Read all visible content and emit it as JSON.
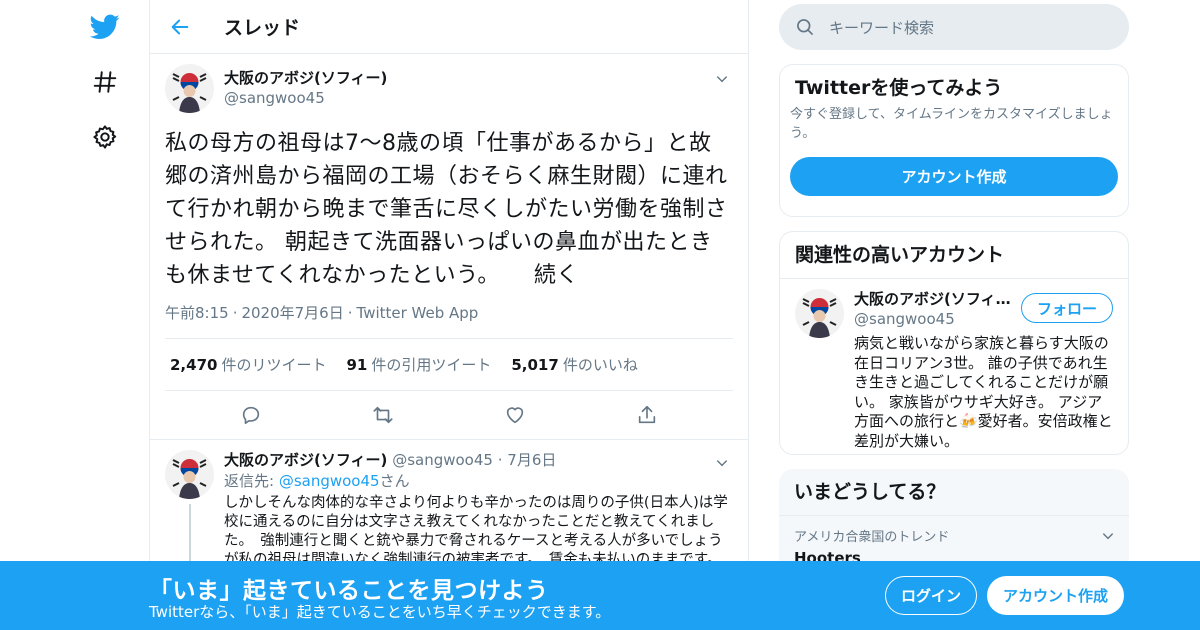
{
  "colors": {
    "accent": "#1da1f2",
    "muted": "#657786",
    "border": "#e6ecf0"
  },
  "nav": {
    "icons": [
      "twitter-logo-icon",
      "hashtag-icon",
      "gear-icon"
    ]
  },
  "header": {
    "title": "スレッド"
  },
  "tweet": {
    "author_name": "大阪のアボジ(ソフィー)",
    "author_handle": "@sangwoo45",
    "text": "私の母方の祖母は7～8歳の頃「仕事があるから」と故郷の済州島から福岡の工場（おそらく麻生財閥）に連れて行かれ朝から晩まで筆舌に尽くしがたい労働を強制させられた。 朝起きて洗面器いっぱいの鼻血が出たときも休ませてくれなかったという。　　続く",
    "time": "午前8:15",
    "date": "2020年7月6日",
    "source": "Twitter Web App",
    "retweets": "2,470",
    "retweets_label": "件のリツイート",
    "quotes": "91",
    "quotes_label": "件の引用ツイート",
    "likes": "5,017",
    "likes_label": "件のいいね"
  },
  "reply": {
    "author_name": "大阪のアボジ(ソフィー)",
    "author_handle": "@sangwoo45",
    "date": "7月6日",
    "reply_prefix": "返信先: ",
    "reply_handle": "@sangwoo45",
    "reply_suffix": "さん",
    "text": "しかしそんな肉体的な辛さより何よりも辛かったのは周りの子供(日本人)は学校に通えるのに自分は文字さえ教えてくれなかったことだと教えてくれました。　強制連行と聞くと銃や暴力で脅されるケースと考える人が多いでしょうが私の祖母は間違いなく強制連行の被害者です。　賃金も未払いのままです。"
  },
  "search": {
    "placeholder": "キーワード検索"
  },
  "signup_card": {
    "title": "Twitterを使ってみよう",
    "desc": "今すぐ登録して、タイムラインをカスタマイズしましょう。",
    "button": "アカウント作成"
  },
  "related": {
    "title": "関連性の高いアカウント",
    "name": "大阪のアボジ(ソフィー)",
    "handle": "@sangwoo45",
    "follow": "フォロー",
    "bio": "病気と戦いながら家族と暮らす大阪の在日コリアン3世。 誰の子供であれ生き生きと過ごしてくれることだけが願い。 家族皆がウサギ大好き。 アジア方面への旅行と🍻愛好者。安倍政権と差別が大嫌い。"
  },
  "trends": {
    "title": "いまどうしてる？",
    "context": "アメリカ合衆国のトレンド",
    "name": "Hooters"
  },
  "bottom_bar": {
    "title": "「いま」起きていることを見つけよう",
    "subtitle": "Twitterなら、「いま」起きていることをいち早くチェックできます。",
    "login": "ログイン",
    "signup": "アカウント作成"
  }
}
